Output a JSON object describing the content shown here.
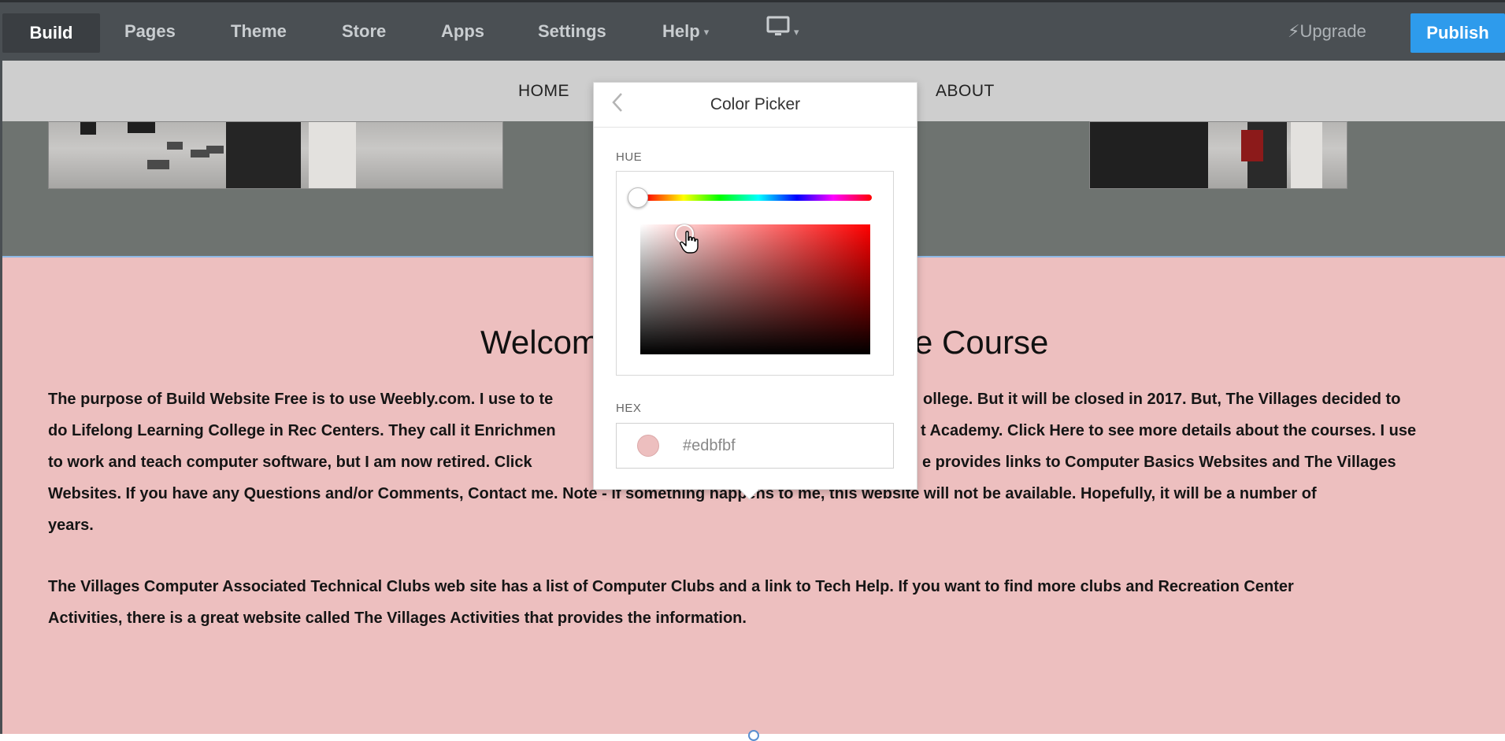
{
  "toolbar": {
    "build": "Build",
    "pages": "Pages",
    "theme": "Theme",
    "store": "Store",
    "apps": "Apps",
    "settings": "Settings",
    "help": "Help",
    "device_icon": "desktop-monitor-icon",
    "upgrade": "Upgrade",
    "upgrade_icon": "lightning-bolt-icon",
    "publish": "Publish",
    "accent_color": "#2e9bec"
  },
  "site_nav": {
    "home": "HOME",
    "about": "ABOUT"
  },
  "picker": {
    "title": "Color Picker",
    "back_icon": "chevron-left-icon",
    "hue_label": "HUE",
    "hex_label": "HEX",
    "hex_value": "#edbfbf",
    "selected_color": "#edbfbf",
    "base_hue_color": "#ff0000"
  },
  "content": {
    "background_color": "#edbfbf",
    "welcome_left": "Welcom",
    "welcome_right": "e Course",
    "p1_lines": [
      {
        "left": "The purpose of Build Website Free is to use Weebly.com.  I use to te",
        "right": "ollege. But it will be closed in 2017.  But, The Villages decided to"
      },
      {
        "left": "do Lifelong Learning College in Rec Centers.  They call it Enrichmen",
        "right": "t Academy.  Click Here to see more details about the courses.  I use"
      },
      {
        "left": "to work and teach computer software, but I am now retired.  Click",
        "right": "e provides links to Computer Basics Websites and The Villages"
      }
    ],
    "p1_line4": "Websites.  If you have any Questions and/or Comments, Contact me. Note - if something happens to me, this website will not be available.  Hopefully, it will be a number of",
    "p1_line5": "years.",
    "p2_line1": "The Villages Computer  Associated Technical Clubs web site has a list of Computer Clubs and a link to Tech Help.  If you want to find more clubs and Recreation Center",
    "p2_line2": "Activities, there is a great website called The Villages Activities that provides the information."
  }
}
